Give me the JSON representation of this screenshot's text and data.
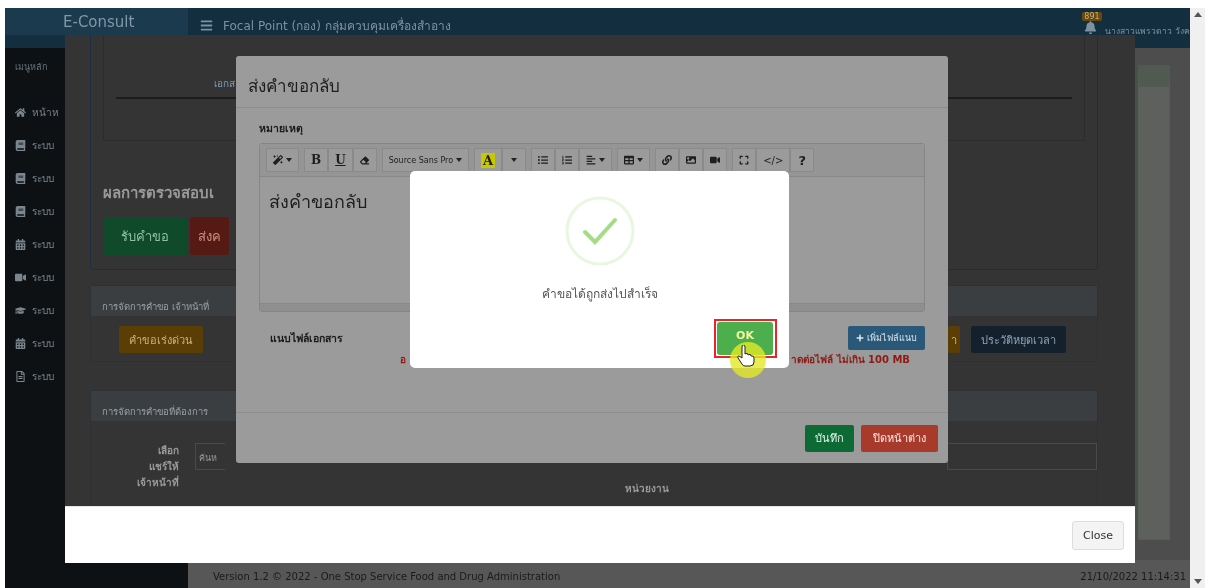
{
  "app": {
    "logo": "E-Consult",
    "title": "Focal Point (กอง) กลุ่มควบคุมเครื่องสำอาง",
    "notification_count": "891",
    "user": "นางสาวแพรวดาว วังค"
  },
  "sidebar": {
    "heading": "เมนูหลัก",
    "items": [
      {
        "label": "หน้าห"
      },
      {
        "label": "ระบบ"
      },
      {
        "label": "ระบบ"
      },
      {
        "label": "ระบบ"
      },
      {
        "label": "ระบบ"
      },
      {
        "label": "ระบบ"
      },
      {
        "label": "ระบบ"
      },
      {
        "label": "ระบบ"
      },
      {
        "label": "ระบบ"
      }
    ]
  },
  "footer": {
    "version": "Version 1.2 © 2022 - One Stop Service Food and Drug Administration",
    "timestamp": "21/10/2022 11:14:31"
  },
  "outer_dialog": {
    "page": {
      "document_label": "เอกส",
      "results_heading": "ผลการตรวจสอบเ",
      "result_buttons": [
        {
          "label": "รับคำขอ",
          "kind": "accept"
        },
        {
          "label": "ส่งค",
          "kind": "return"
        }
      ],
      "officer_panel": {
        "title": "การจัดการคำขอ เจ้าหน้าที่",
        "buttons": [
          {
            "label": "คำขอเร่งด่วน",
            "kind": "urgent"
          },
          {
            "label": "า",
            "kind": "urgent"
          },
          {
            "label": "ประวัติหยุดเวลา",
            "kind": "history"
          }
        ]
      },
      "request_panel": {
        "title": "การจัดการคำขอที่ต้องการ",
        "share_label": "เลือก\nแชร์ให้\nเจ้าหน้าที่",
        "search_placeholder": "ค้นห",
        "unit_label": "หน่วยงาน"
      }
    },
    "close_button": "Close"
  },
  "return_dialog": {
    "title": "ส่งคำขอกลับ",
    "note_label": "หมายเหตุ",
    "toolbar": {
      "bold": "B",
      "underline": "U",
      "font": "Source Sans Pro",
      "highlight": "A",
      "code": "</>",
      "help": "?"
    },
    "note_text": "ส่งคำขอกลับ",
    "attach_label": "แนบไฟล์เอกสาร",
    "add_file_button": "เพิ่มไฟล์แนบ",
    "size_note_parts": [
      "อ",
      "าดต่อไฟล์ ไม่เกิน 100 MB"
    ],
    "buttons": [
      {
        "label": "บันทึก",
        "kind": "save"
      },
      {
        "label": "ปิดหน้าต่าง",
        "kind": "close"
      }
    ]
  },
  "alert": {
    "message": "คำขอได้ถูกส่งไปสำเร็จ",
    "confirm_button": "OK"
  }
}
